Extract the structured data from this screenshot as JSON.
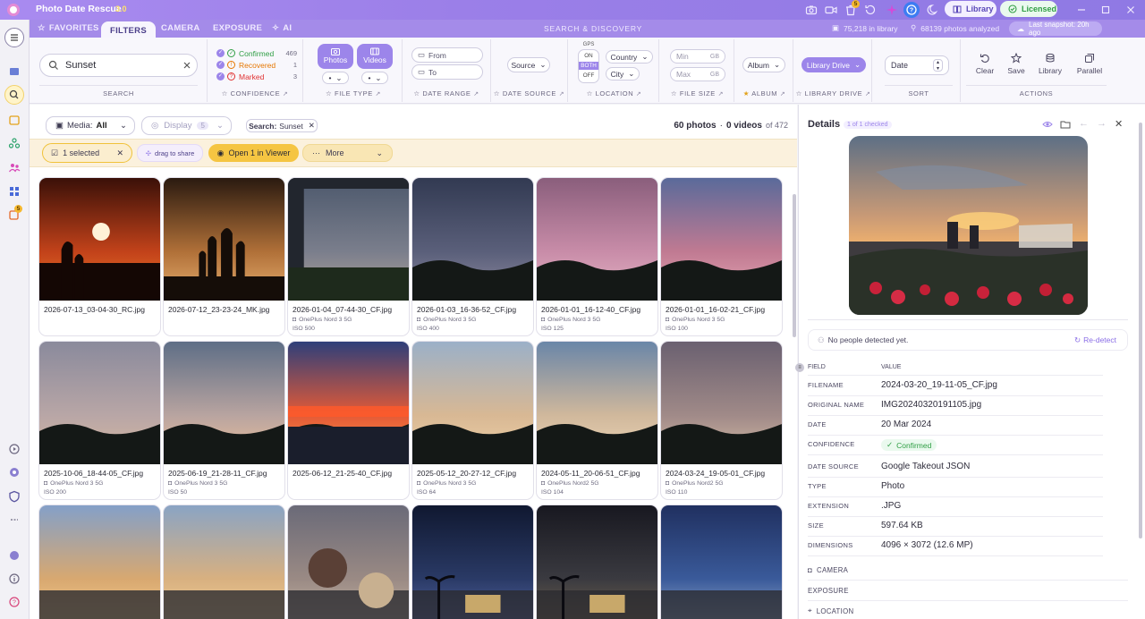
{
  "app": {
    "name": "Photo Date Rescue",
    "version": "3.0",
    "notify_count": "5"
  },
  "titlebar": {
    "library_label": "Library",
    "licensed_label": "Licensed"
  },
  "nav": {
    "favorites": "FAVORITES",
    "filters": "FILTERS",
    "camera": "CAMERA",
    "exposure": "EXPOSURE",
    "ai": "AI",
    "center_title": "SEARCH & DISCOVERY",
    "library_count": "75,218 in library",
    "analyzed": "68139 photos analyzed",
    "snapshot": "Last snapshot: 20h ago"
  },
  "sidebar": {
    "badge": "5"
  },
  "filters": {
    "search": {
      "value": "Sunset",
      "label": "SEARCH"
    },
    "confidence": {
      "label": "CONFIDENCE",
      "items": [
        {
          "name": "Confirmed",
          "count": "469",
          "color": "#2f9e44"
        },
        {
          "name": "Recovered",
          "count": "1",
          "color": "#e67700"
        },
        {
          "name": "Marked",
          "count": "3",
          "color": "#e03131"
        }
      ]
    },
    "file_type": {
      "label": "FILE TYPE",
      "photos": "Photos",
      "videos": "Videos",
      "sel1": "•",
      "sel2": "•"
    },
    "date_range": {
      "label": "DATE RANGE",
      "from": "From",
      "to": "To"
    },
    "date_source": {
      "label": "DATE SOURCE",
      "value": "Source"
    },
    "location": {
      "label": "LOCATION",
      "gps": "GPS",
      "on": "ON",
      "both": "BOTH",
      "off": "OFF",
      "country": "Country",
      "city": "City"
    },
    "file_size": {
      "label": "FILE SIZE",
      "min": "Min",
      "max": "Max",
      "unit": "GB"
    },
    "album": {
      "label": "ALBUM",
      "value": "Album"
    },
    "library_drive": {
      "label": "LIBRARY DRIVE",
      "value": "Library Drive"
    },
    "sort": {
      "label": "SORT",
      "value": "Date"
    },
    "actions": {
      "label": "ACTIONS",
      "clear": "Clear",
      "save": "Save",
      "library": "Library",
      "parallel": "Parallel"
    }
  },
  "toolbar": {
    "media_label": "Media:",
    "media_value": "All",
    "display_label": "Display",
    "display_count": "5",
    "search_chip_label": "Search:",
    "search_chip_value": "Sunset",
    "counts_photos": "60 photos",
    "counts_sep": "·",
    "counts_videos": "0 videos",
    "counts_of": "of 472"
  },
  "selection": {
    "selected": "1 selected",
    "drag": "drag to share",
    "open": "Open 1 in Viewer",
    "more": "More"
  },
  "photos": [
    {
      "fname": "2026-07-13_03-04-30_RC.jpg",
      "camera": "",
      "iso": ""
    },
    {
      "fname": "2026-07-12_23-23-24_MK.jpg",
      "camera": "",
      "iso": ""
    },
    {
      "fname": "2026-01-04_07-44-30_CF.jpg",
      "camera": "OnePlus Nord 3 5G",
      "iso": "ISO 500"
    },
    {
      "fname": "2026-01-03_16-36-52_CF.jpg",
      "camera": "OnePlus Nord 3 5G",
      "iso": "ISO 400"
    },
    {
      "fname": "2026-01-01_16-12-40_CF.jpg",
      "camera": "OnePlus Nord 3 5G",
      "iso": "ISO 125"
    },
    {
      "fname": "2026-01-01_16-02-21_CF.jpg",
      "camera": "OnePlus Nord 3 5G",
      "iso": "ISO 100"
    },
    {
      "fname": "2025-10-06_18-44-05_CF.jpg",
      "camera": "OnePlus Nord 3 5G",
      "iso": "ISO 200"
    },
    {
      "fname": "2025-06-19_21-28-11_CF.jpg",
      "camera": "OnePlus Nord 3 5G",
      "iso": "ISO 50"
    },
    {
      "fname": "2025-06-12_21-25-40_CF.jpg",
      "camera": "",
      "iso": ""
    },
    {
      "fname": "2025-05-12_20-27-12_CF.jpg",
      "camera": "OnePlus Nord 3 5G",
      "iso": "ISO 64"
    },
    {
      "fname": "2024-05-11_20-06-51_CF.jpg",
      "camera": "OnePlus Nord2 5G",
      "iso": "ISO 104"
    },
    {
      "fname": "2024-03-24_19-05-01_CF.jpg",
      "camera": "OnePlus Nord2 5G",
      "iso": "ISO 110"
    }
  ],
  "details": {
    "title": "Details",
    "checked": "1 of 1 checked",
    "people": "No people detected yet.",
    "redetect": "Re-detect",
    "field_header": "FIELD",
    "value_header": "VALUE",
    "fields": [
      {
        "key": "FILENAME",
        "value": "2024-03-20_19-11-05_CF.jpg"
      },
      {
        "key": "ORIGINAL NAME",
        "value": "IMG20240320191105.jpg"
      },
      {
        "key": "DATE",
        "value": "20 Mar 2024"
      },
      {
        "key": "CONFIDENCE",
        "value": "Confirmed"
      },
      {
        "key": "DATE SOURCE",
        "value": "Google Takeout JSON"
      },
      {
        "key": "TYPE",
        "value": "Photo"
      },
      {
        "key": "EXTENSION",
        "value": ".JPG"
      },
      {
        "key": "SIZE",
        "value": "597.64 KB"
      },
      {
        "key": "DIMENSIONS",
        "value": "4096 × 3072 (12.6 MP)"
      }
    ],
    "sections": {
      "camera": "CAMERA",
      "exposure": "EXPOSURE",
      "location": "LOCATION"
    }
  },
  "colors": {
    "accent": "#9b7fe8",
    "selection_bg": "#fbf1dd",
    "confirmed": "#2f9e44"
  }
}
